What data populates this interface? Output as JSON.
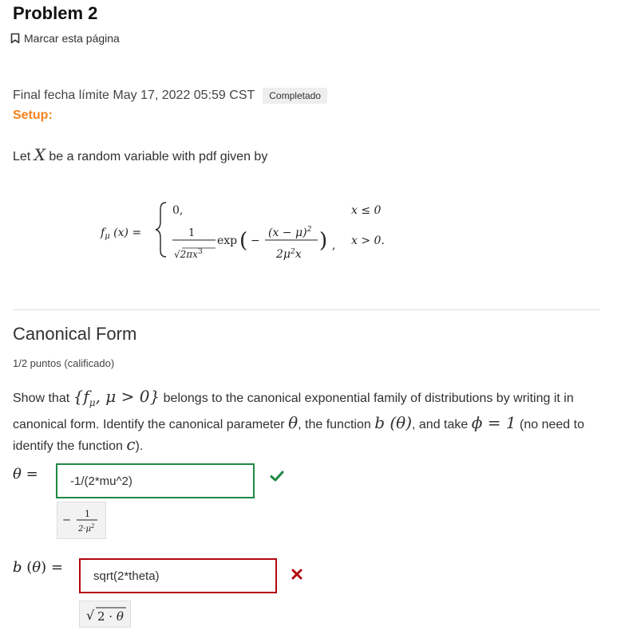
{
  "problem": {
    "title": "Problem 2",
    "bookmark_label": "Marcar esta página"
  },
  "status": {
    "deadline": "Final fecha límite May 17, 2022 05:59 CST",
    "badge": "Completado",
    "setup_label": "Setup:"
  },
  "setup": {
    "intro_before": "Let ",
    "variable": "X",
    "intro_after": " be a random variable with pdf given by"
  },
  "formula": {
    "lhs": "f_μ(x) =",
    "case1_value": "0,",
    "case1_condition": "x ≤ 0",
    "case2_value": "1/√(2πx³) exp(−(x−μ)²/(2μ²x)),",
    "case2_condition": "x > 0."
  },
  "section": {
    "title": "Canonical Form",
    "points": "1/2 puntos (calificado)"
  },
  "question": {
    "p1": "Show that ",
    "family": "{f",
    "family_sub": "μ",
    "family_rest": ", μ > 0}",
    "p2": " belongs to the canonical exponential family of distributions by writing it in canonical form. Identify the canonical parameter ",
    "theta": "θ",
    "p3": ", the function ",
    "b_theta": "b (θ)",
    "p4": ", and take ",
    "phi_eq": "ϕ = 1",
    "p5": " (no need to identify the function ",
    "c": "c",
    "p6": ")."
  },
  "answers": {
    "theta_label": "θ =",
    "theta_input": "-1/(2*mu^2)",
    "theta_status": "correct",
    "b_label": "b (θ) =",
    "b_input": "sqrt(2*theta)",
    "b_status": "incorrect"
  },
  "colors": {
    "accent": "#f58220",
    "correct": "#1f8844",
    "incorrect": "#b20610"
  },
  "icons": [
    "bookmark-icon",
    "check-icon",
    "cross-icon"
  ]
}
